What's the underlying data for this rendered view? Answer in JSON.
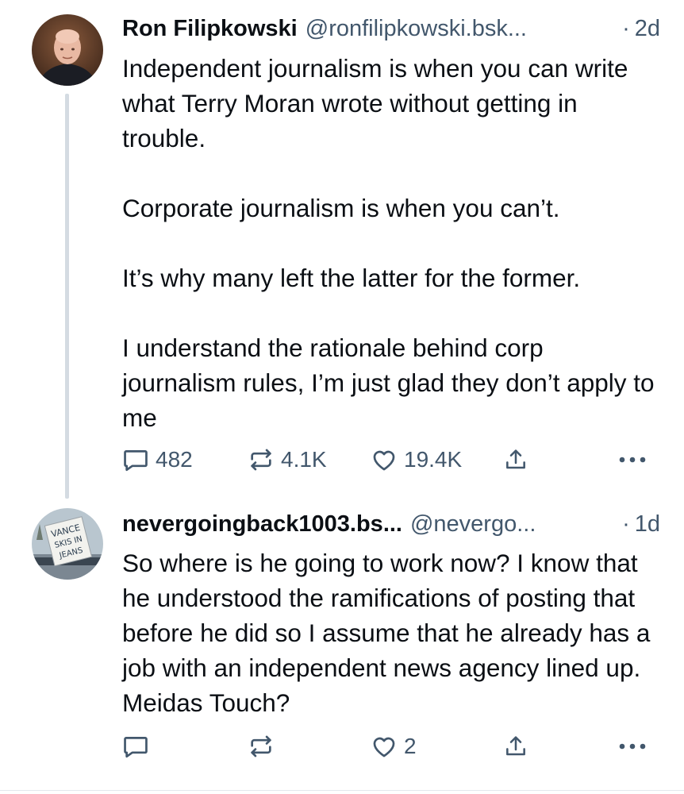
{
  "posts": [
    {
      "author": "Ron Filipkowski",
      "handle": "@ronfilipkowski.bsk...",
      "dot": "·",
      "time": "2d",
      "paragraphs": [
        "Independent journalism is when you can write what Terry Moran wrote without getting in trouble.",
        "Corporate journalism is when you can’t.",
        "It’s why many left the latter for the former.",
        "I understand the rationale behind corp journalism rules, I’m just glad they don’t apply to me"
      ],
      "replies": "482",
      "reposts": "4.1K",
      "likes": "19.4K"
    },
    {
      "author": "nevergoingback1003.bs...",
      "handle": "@nevergo...",
      "dot": "·",
      "time": "1d",
      "paragraphs": [
        "So where is he going to work now? I know that he understood the ramifications of posting that before he did so I assume that he already has a job with an independent news agency lined up. Meidas Touch?"
      ],
      "avatar_sign_text": "VANCE SKIS IN JEANS",
      "replies": "",
      "reposts": "",
      "likes": "2"
    }
  ],
  "icons": {
    "reply": "speech-bubble-icon",
    "repost": "repost-arrows-icon",
    "like": "heart-icon",
    "share": "share-upload-icon",
    "more": "more-dots-icon"
  },
  "colors": {
    "text": "#0b0f14",
    "muted": "#42576c",
    "thread_line": "#d4dbe2"
  }
}
